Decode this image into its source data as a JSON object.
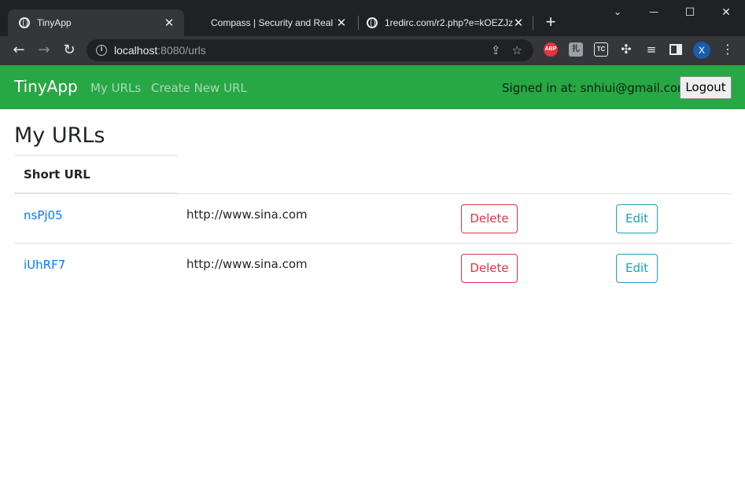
{
  "browser": {
    "tabs": [
      {
        "title": "TinyApp",
        "active": true
      },
      {
        "title": "Compass | Security and Real W",
        "active": false
      },
      {
        "title": "1redirc.com/r2.php?e=kOEZJz",
        "active": false
      }
    ],
    "new_tab_symbol": "+",
    "window_controls": {
      "minimize": "—",
      "maximize": "☐",
      "close": "✕"
    },
    "address_host": "localhost",
    "address_rest": ":8080/urls",
    "extensions": {
      "abp": "ABP",
      "k": "扎",
      "tc": "TC"
    },
    "profile_initial": "X"
  },
  "navbar": {
    "brand": "TinyApp",
    "links": [
      "My URLs",
      "Create New URL"
    ],
    "signed_in_text": "Signed in at: snhiui@gmail.com",
    "logout_label": "Logout",
    "color": "#28a745"
  },
  "main": {
    "title": "My URLs",
    "table_header": "Short URL",
    "rows": [
      {
        "short": "nsPj05",
        "long": "http://www.sina.com",
        "delete_label": "Delete",
        "edit_label": "Edit"
      },
      {
        "short": "iUhRF7",
        "long": "http://www.sina.com",
        "delete_label": "Delete",
        "edit_label": "Edit"
      }
    ]
  },
  "colors": {
    "link": "#007bff",
    "danger": "#dc3545",
    "info": "#17a2b8"
  }
}
